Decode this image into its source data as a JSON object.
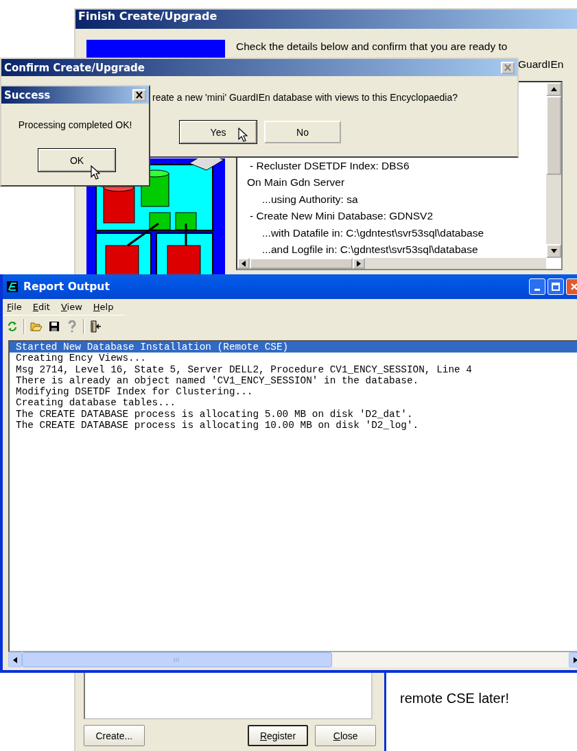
{
  "finish_window": {
    "title": "Finish Create/Upgrade",
    "intro": [
      "Check the details below and confirm that you are ready to",
      "GuardIEn"
    ],
    "details": [
      "- Recluster DSETDF Index: DBS6",
      "On Main Gdn Server",
      "...using Authority: sa",
      "- Create New Mini Database: GDNSV2",
      "...with Datafile in: C:\\gdntest\\svr53sql\\database",
      "...and Logfile in: C:\\gdntest\\svr53sql\\database"
    ]
  },
  "confirm_dialog": {
    "title": "Confirm Create/Upgrade",
    "question": "reate a new 'mini' GuardIEn database with views to this Encyclopaedia?",
    "buttons": [
      {
        "label": "Yes",
        "default": true
      },
      {
        "label": "No",
        "default": false
      }
    ]
  },
  "success_dialog": {
    "title": "Success",
    "message": "Processing completed OK!",
    "buttons": [
      {
        "label": "OK",
        "default": true
      }
    ]
  },
  "report_window": {
    "title": "Report Output",
    "menu": [
      "File",
      "Edit",
      "View",
      "Help"
    ],
    "lines": [
      {
        "text": "Started New Database Installation (Remote CSE)",
        "selected": true
      },
      {
        "text": "Creating Ency Views...",
        "selected": false
      },
      {
        "text": "Msg 2714, Level 16, State 5, Server DELL2, Procedure CV1_ENCY_SESSION, Line 4",
        "selected": false
      },
      {
        "text": "There is already an object named 'CV1_ENCY_SESSION' in the database.",
        "selected": false
      },
      {
        "text": "Modifying DSETDF Index for Clustering...",
        "selected": false
      },
      {
        "text": "Creating database tables...",
        "selected": false
      },
      {
        "text": "The CREATE DATABASE process is allocating 5.00 MB on disk 'D2_dat'.",
        "selected": false
      },
      {
        "text": "The CREATE DATABASE process is allocating 10.00 MB on disk 'D2_log'.",
        "selected": false
      }
    ]
  },
  "bottom_dialog": {
    "buttons": [
      {
        "label": "Create...",
        "access_key": false,
        "default": false
      },
      {
        "label": "Register",
        "access_key": true,
        "default": true
      },
      {
        "label": "Close",
        "access_key": true,
        "default": false
      }
    ]
  },
  "note": "remote CSE later!"
}
